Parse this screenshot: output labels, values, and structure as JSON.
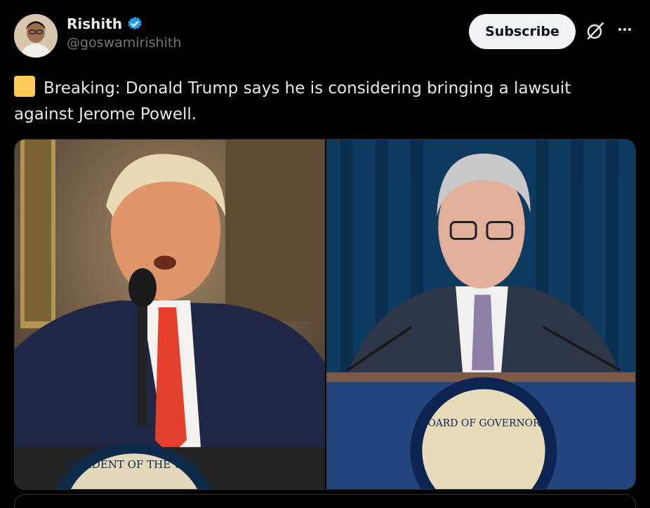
{
  "author": {
    "display_name": "Rishith",
    "handle": "@goswamirishith",
    "verified": true
  },
  "actions": {
    "subscribe_label": "Subscribe"
  },
  "icons": {
    "verified": "verified-badge-icon",
    "grok": "grok-icon",
    "more": "more-options-icon",
    "emoji": "yellow-square-emoji"
  },
  "post": {
    "text": "Breaking: Donald Trump says he is considering bringing a lawsuit against Jerome Powell."
  },
  "media": {
    "seal_left_text": "RESIDENT OF THE UNIT",
    "seal_right_text": "BOARD OF GOVERNORS"
  },
  "colors": {
    "background": "#000000",
    "text": "#e7e9ea",
    "muted": "#71767b",
    "verified": "#1d9bf0",
    "emoji": "#fdcb58"
  }
}
